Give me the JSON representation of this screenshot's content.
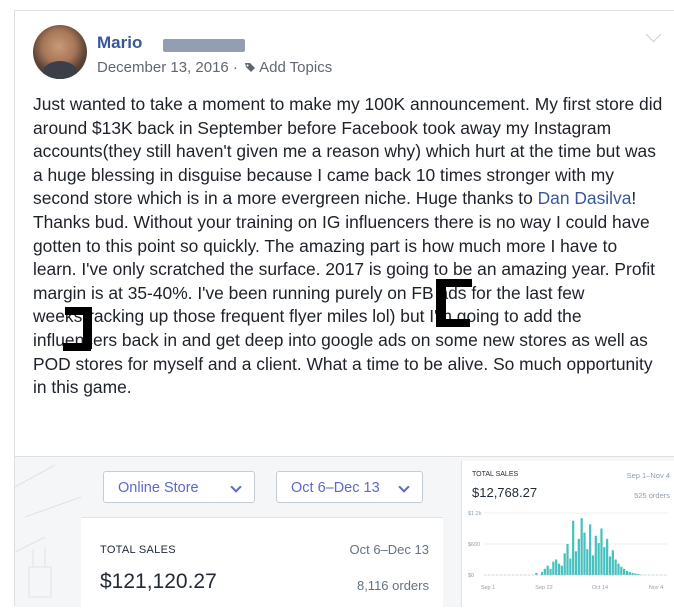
{
  "post": {
    "author": "Mario",
    "date": "December 13, 2016 ·",
    "add_topics": "Add Topics",
    "body_before": "Just wanted to take a moment to make my 100K announcement. My first store did around $13K back in September before Facebook took away my Instagram accounts(they still haven't given me a reason why) which hurt at the time but was a huge blessing in disguise because I came back 10 times stronger with my second store which is in a more evergreen niche. Huge thanks to ",
    "mention": "Dan Dasilva",
    "body_after": "! Thanks bud. Without your training on IG influencers there is no way I could have gotten to this point so quickly. The amazing part is how much more I have to learn. I've only scratched the surface. 2017 is going to be an amazing year. Profit margin is at 35-40%. I've been running purely on FB ads for the last few weeks(racking up those frequent flyer miles lol) but I'm going to add the influencers back in and get deep into google ads on some new stores as well as POD stores for myself and a client. What a time to be alive. So much opportunity in this game."
  },
  "shop": {
    "channel_select": "Online Store",
    "date_select": "Oct 6–Dec 13",
    "total_label": "TOTAL SALES",
    "total_range": "Oct 6–Dec 13",
    "total_amount": "$121,120.27",
    "total_orders": "8,116 orders"
  },
  "mini_chart": {
    "label": "TOTAL SALES",
    "range": "Sep 1–Nov 4",
    "amount": "$12,768.27",
    "orders": "525 orders",
    "accent": "#47c1bf"
  },
  "chart_data": {
    "type": "bar",
    "title": "TOTAL SALES",
    "ylim": [
      0,
      1200
    ],
    "y_ticks": [
      "$1.2k",
      "$600",
      "$0"
    ],
    "x_ticks": [
      "Sep 1",
      "Sep 22",
      "Oct 14",
      "Nov 4"
    ],
    "values": [
      0,
      0,
      0,
      0,
      0,
      0,
      0,
      0,
      0,
      0,
      0,
      0,
      0,
      0,
      0,
      0,
      0,
      0,
      40,
      0,
      60,
      120,
      180,
      120,
      260,
      300,
      220,
      180,
      420,
      600,
      320,
      1050,
      460,
      700,
      1100,
      820,
      500,
      980,
      380,
      760,
      620,
      900,
      540,
      700,
      360,
      480,
      300,
      220,
      160,
      120,
      80,
      60,
      40,
      30,
      20,
      10,
      0,
      0,
      0,
      0,
      0,
      0,
      0,
      0,
      0
    ]
  }
}
